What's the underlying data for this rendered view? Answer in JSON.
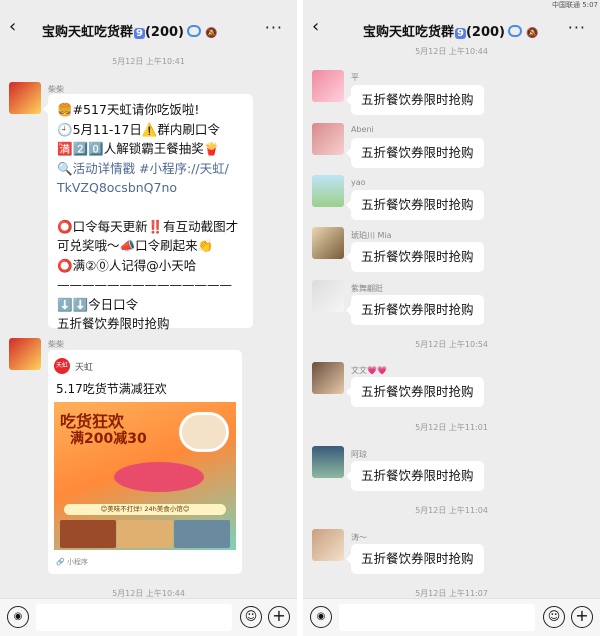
{
  "status_left": "中国联通",
  "status_right": "5:07",
  "header": {
    "back_icon": "‹",
    "title": "宝购天虹吃货群",
    "badge": "9",
    "count": "(200)",
    "more": "···"
  },
  "left": {
    "time1": "5月12日 上午10:41",
    "msg1": {
      "nick": "柴柴",
      "lines": [
        "🍔#517天虹请你吃饭啦!",
        "🕘5月11-17日⚠️群内刷口令",
        "🈵2️⃣0️⃣人解锁霸王餐抽奖🍟",
        "🔍活动详情戳 #小程序://天虹/",
        "TkVZQ8ocsbnQ7no",
        "",
        "⭕口令每天更新‼️有互动截图才",
        "可兑奖哦～📣口令刷起来👏",
        "⭕满②⓪人记得@小天哈",
        "——————————————",
        "⬇️⬇️今日口令",
        "五折餐饮券限时抢购"
      ]
    },
    "msg2": {
      "nick": "柴柴",
      "card_logo": "天虹",
      "card_source": "天虹",
      "card_title": "5.17吃货节满减狂欢",
      "promo1": "吃货狂欢",
      "promo2": "满200减30",
      "strip": "😊美味不打烊! 24h美食小馆😊",
      "mini_label": "小程序"
    },
    "time2": "5月12日 上午10:44"
  },
  "right": {
    "time1": "5月12日 上午10:44",
    "m1": {
      "nick": "平",
      "text": "五折餐饮券限时抢购"
    },
    "m2": {
      "nick": "Abeni",
      "text": "五折餐饮券限时抢购"
    },
    "m3": {
      "nick": "yao",
      "text": "五折餐饮券限时抢购"
    },
    "m4": {
      "nick": "琥珀川 Mia",
      "text": "五折餐饮券限时抢购"
    },
    "m5": {
      "nick": "紫舞翩跹",
      "text": "五折餐饮券限时抢购"
    },
    "time2": "5月12日 上午10:54",
    "m6": {
      "nick": "文文💗💗",
      "text": "五折餐饮券限时抢购"
    },
    "time3": "5月12日 上午11:01",
    "m7": {
      "nick": "阿琼",
      "text": "五折餐饮券限时抢购"
    },
    "time4": "5月12日 上午11:04",
    "m8": {
      "nick": "涛～",
      "text": "五折餐饮券限时抢购"
    },
    "time5": "5月12日 上午11:07"
  },
  "input": {
    "voice_icon": "◉",
    "emoji_icon": "☺",
    "plus_icon": "+"
  },
  "colors": {
    "bg": "#ededed",
    "bubble": "#ffffff",
    "link": "#4f6a94",
    "badge": "#5b7fe0"
  }
}
